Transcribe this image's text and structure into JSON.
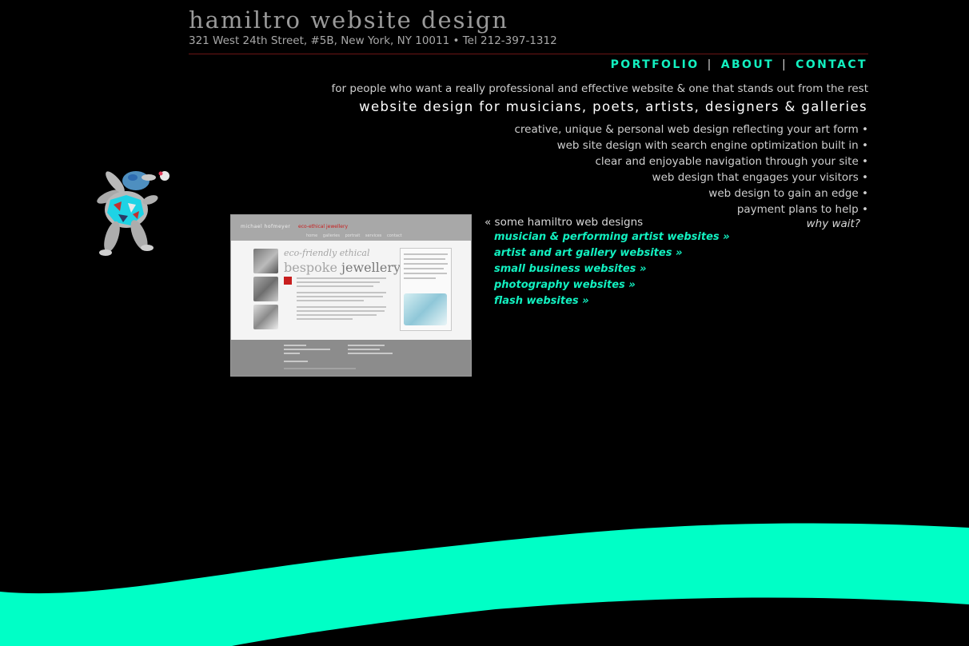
{
  "header": {
    "brand": "hamiltro website design",
    "address": "321 West 24th Street, #5B, New York, NY 10011 • Tel 212-397-1312"
  },
  "nav": {
    "items": [
      "PORTFOLIO",
      "ABOUT",
      "CONTACT"
    ],
    "separator": "|"
  },
  "intro": {
    "tagline": "for people who want a really professional and effective website & one that stands out from the rest",
    "subhead": "website design for musicians, poets, artists, designers & galleries"
  },
  "features": [
    "creative, unique & personal web design reflecting your art form •",
    "web site design with search engine optimization built in •",
    "clear and enjoyable navigation through your site •",
    "web design that engages your visitors •",
    "web design to gain an edge •",
    "payment plans to help •"
  ],
  "why_wait": "why wait?",
  "portfolio_thumbnail": {
    "site_name": "michael hofmeyer",
    "site_tag": "eco-ethical jewellery",
    "menu": "home galleries portrait services contact",
    "heading_line1": "eco-friendly ethical",
    "heading_line2_a": "bespoke ",
    "heading_line2_b": "jewellery"
  },
  "designs": {
    "heading": "« some hamiltro web designs",
    "links": [
      "musician & performing artist websites »",
      "artist and art gallery websites »",
      "small business websites »",
      "photography websites »",
      "flash websites »"
    ]
  },
  "colors": {
    "accent": "#12f0c0",
    "background": "#000000",
    "rule": "#6b1515",
    "wave": "#00ffc6"
  },
  "icons": {
    "mascot": "rabbit-mascot-illustration"
  }
}
